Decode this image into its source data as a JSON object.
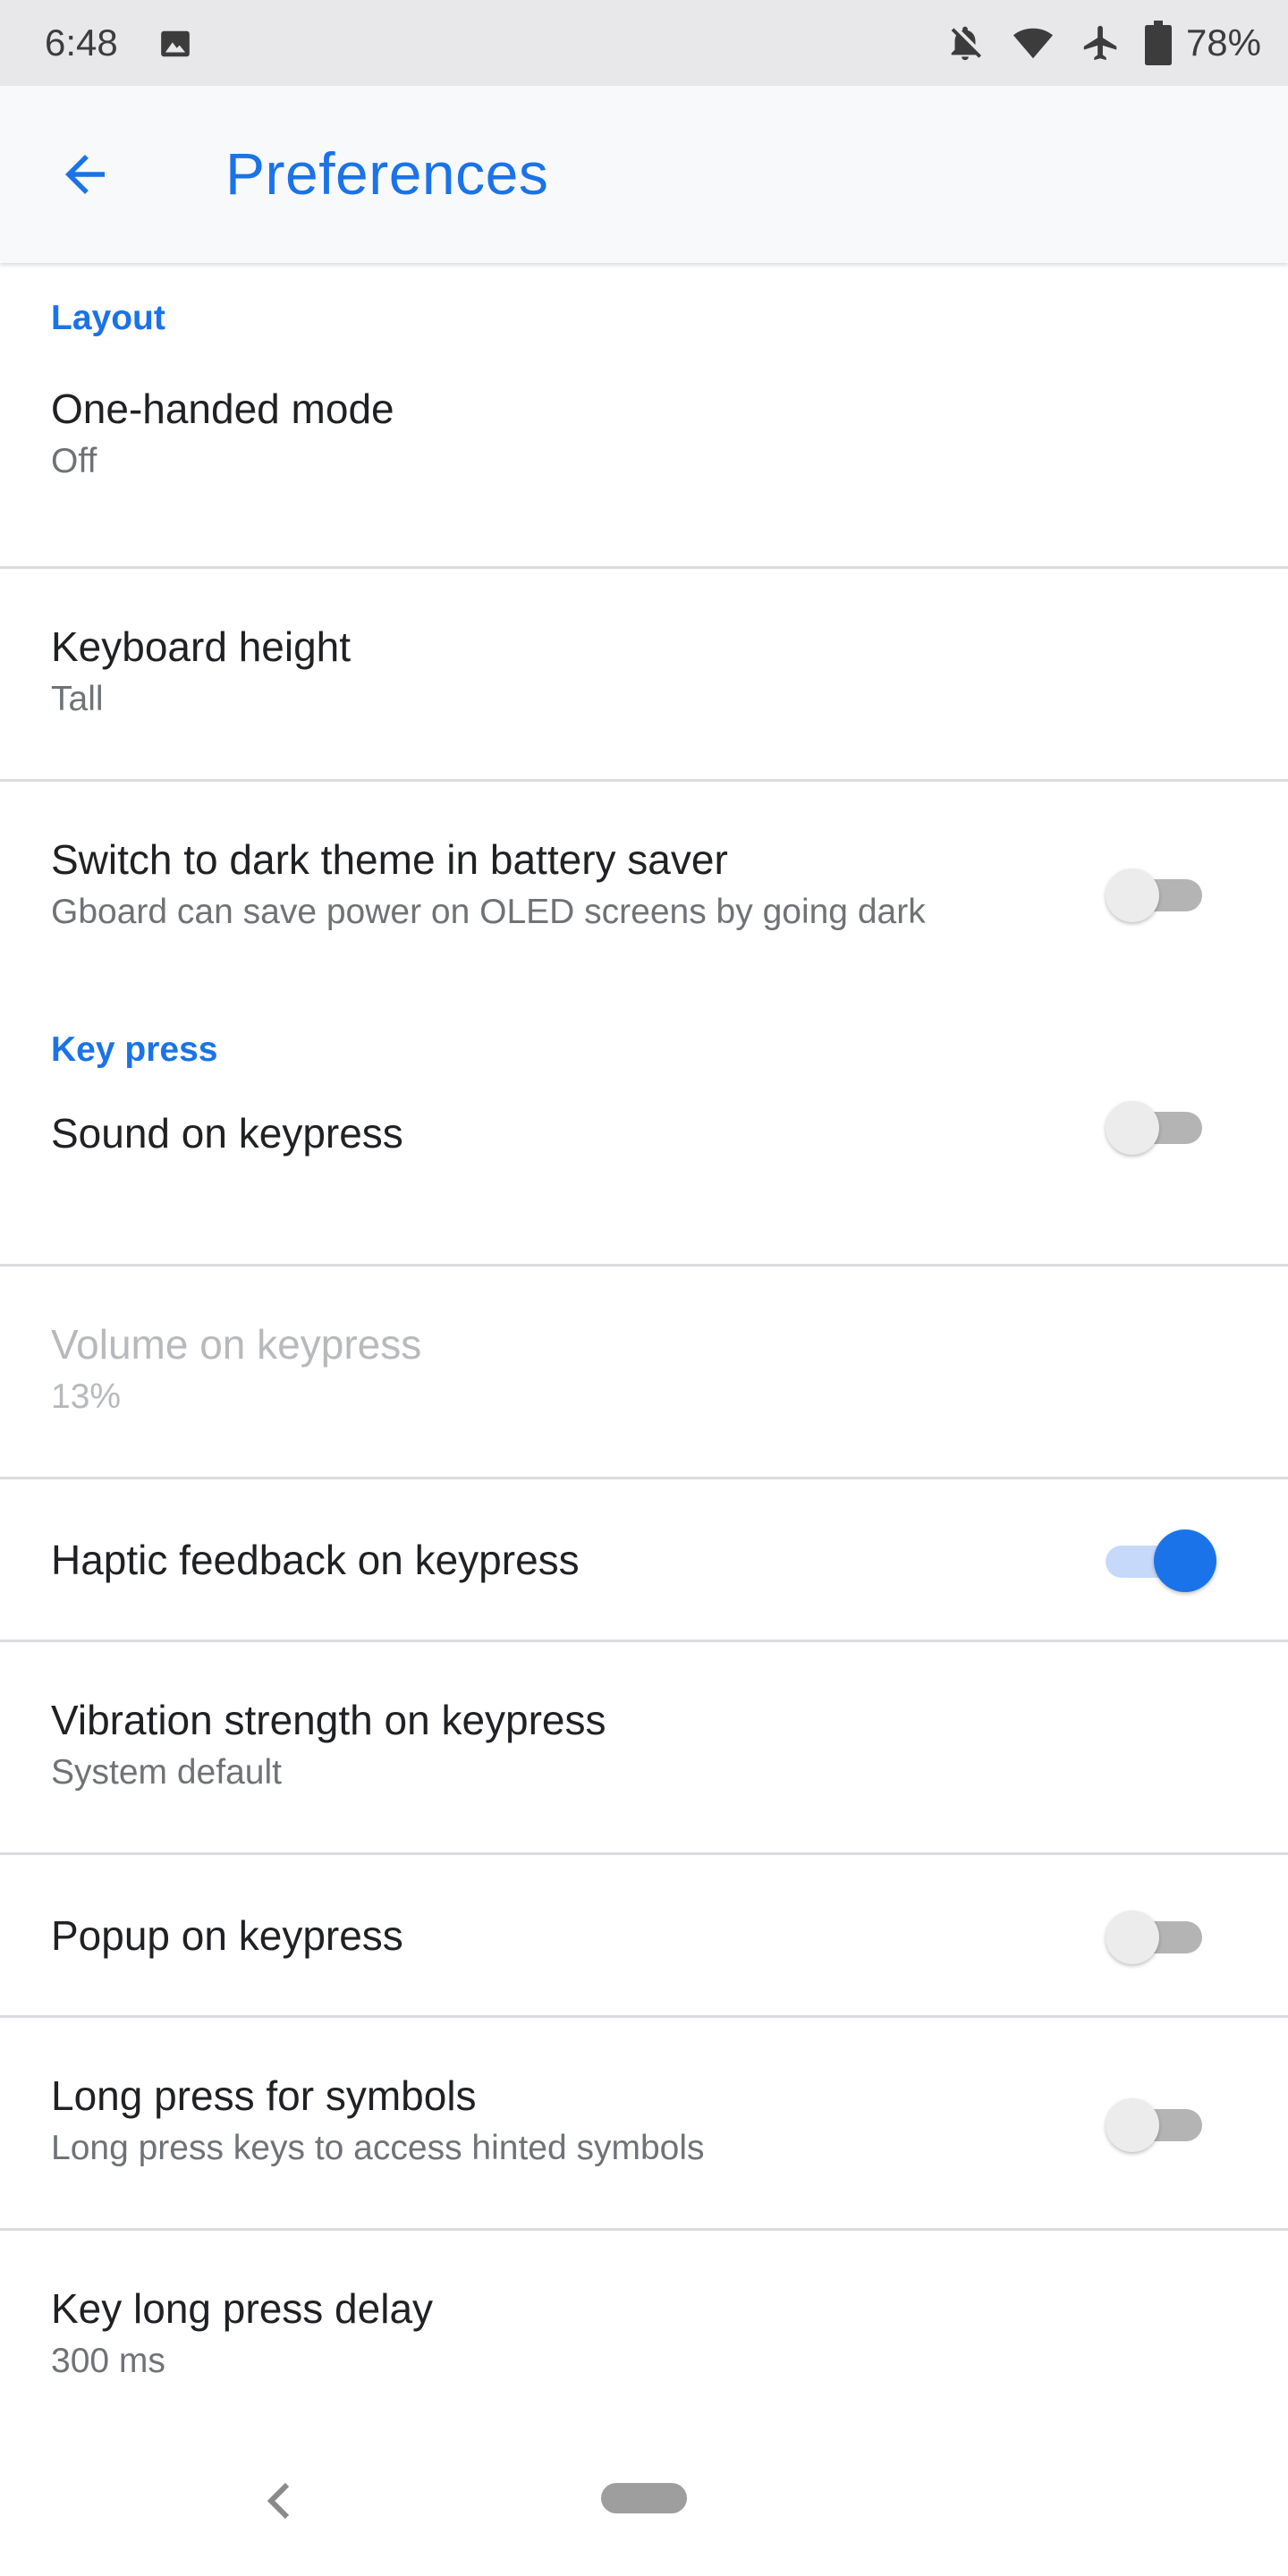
{
  "status_bar": {
    "time": "6:48",
    "battery_percent": "78%",
    "icons": [
      "image-icon",
      "notifications-off-icon",
      "wifi-icon",
      "airplane-icon",
      "battery-icon"
    ]
  },
  "app_bar": {
    "title": "Preferences",
    "back_icon": "arrow-back-icon"
  },
  "sections": {
    "layout": {
      "header": "Layout",
      "items": {
        "one_handed": {
          "title": "One-handed mode",
          "summary": "Off"
        },
        "keyboard_height": {
          "title": "Keyboard height",
          "summary": "Tall"
        },
        "dark_theme": {
          "title": "Switch to dark theme in battery saver",
          "summary": "Gboard can save power on OLED screens by going dark",
          "enabled": false
        }
      }
    },
    "key_press": {
      "header": "Key press",
      "items": {
        "sound": {
          "title": "Sound on keypress",
          "enabled": false
        },
        "volume": {
          "title": "Volume on keypress",
          "summary": "13%",
          "disabled": true
        },
        "haptic": {
          "title": "Haptic feedback on keypress",
          "enabled": true
        },
        "vibration": {
          "title": "Vibration strength on keypress",
          "summary": "System default"
        },
        "popup": {
          "title": "Popup on keypress",
          "enabled": false
        },
        "long_press_symbols": {
          "title": "Long press for symbols",
          "summary": "Long press keys to access hinted symbols",
          "enabled": false
        },
        "long_press_delay": {
          "title": "Key long press delay",
          "summary": "300 ms"
        }
      }
    }
  },
  "colors": {
    "accent": "#1a73e8",
    "accent_track": "#c6d9fa",
    "divider": "#dadce0",
    "status_bar_bg": "#e8e8ea",
    "app_bar_bg": "#f8f9fa"
  },
  "nav_bar": {
    "icons": [
      "nav-back-icon",
      "home-pill"
    ]
  }
}
